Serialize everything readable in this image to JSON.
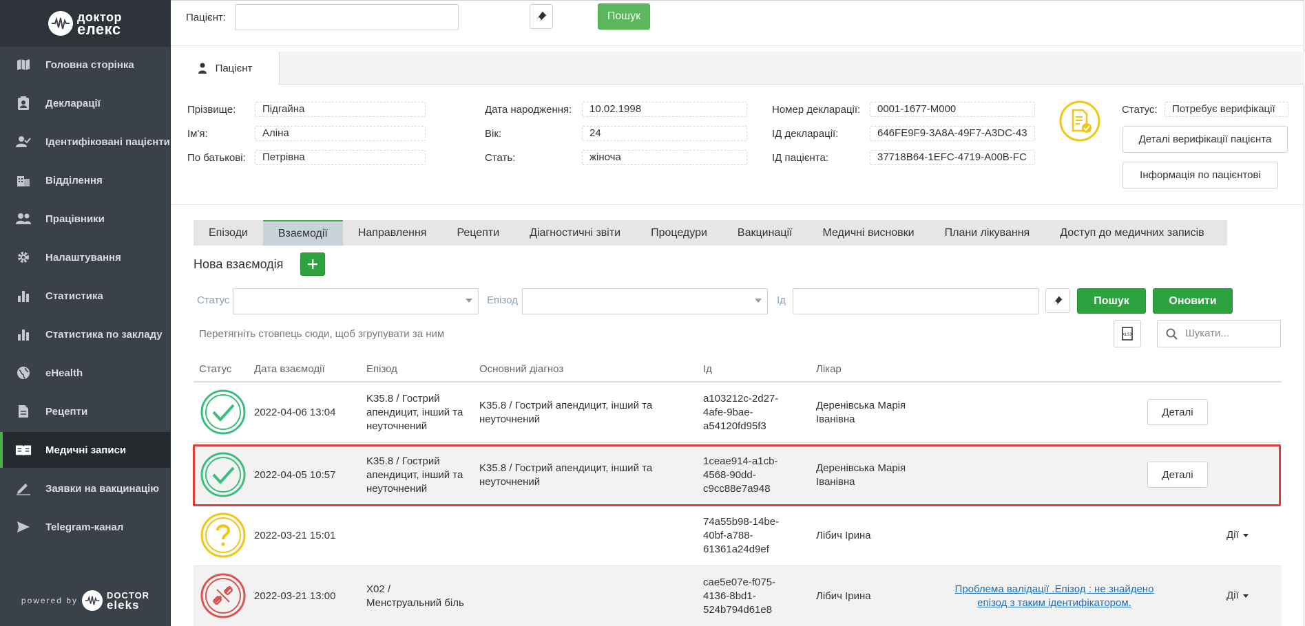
{
  "brand": {
    "logo_line1": "доктор",
    "logo_line2": "елекс",
    "powered_by": "powered by",
    "footer_line1": "DOCTOR",
    "footer_line2": "eleks"
  },
  "sidebar": {
    "items": [
      {
        "label": "Головна сторінка",
        "icon": "map-icon"
      },
      {
        "label": "Декларації",
        "icon": "clipboard-person-icon"
      },
      {
        "label": "Ідентифіковані пацієнти",
        "icon": "person-check-icon"
      },
      {
        "label": "Відділення",
        "icon": "building-icon"
      },
      {
        "label": "Працівники",
        "icon": "people-icon"
      },
      {
        "label": "Налаштування",
        "icon": "gear-icon"
      },
      {
        "label": "Статистика",
        "icon": "bar-chart-icon"
      },
      {
        "label": "Статистика по закладу",
        "icon": "bar-chart-icon"
      },
      {
        "label": "eHealth",
        "icon": "globe-icon"
      },
      {
        "label": "Рецепти",
        "icon": "document-icon"
      },
      {
        "label": "Медичні записи",
        "icon": "book-icon",
        "active": true
      },
      {
        "label": "Заявки на вакцинацію",
        "icon": "pencil-icon"
      },
      {
        "label": "Telegram-канал",
        "icon": "send-icon"
      }
    ]
  },
  "search": {
    "patient_label": "Пацієнт:",
    "patient_value": "",
    "search_button": "Пошук"
  },
  "patient_tab": {
    "label": "Пацієнт"
  },
  "patient": {
    "surname_label": "Прізвище:",
    "surname": "Підгайна",
    "name_label": "Ім'я:",
    "name": "Аліна",
    "patronymic_label": "По батькові:",
    "patronymic": "Петрівна",
    "dob_label": "Дата народження:",
    "dob": "10.02.1998",
    "age_label": "Вік:",
    "age": "24",
    "sex_label": "Стать:",
    "sex": "жіноча",
    "decl_num_label": "Номер декларації:",
    "decl_num": "0001-1677-M000",
    "decl_id_label": "ІД декларації:",
    "decl_id": "646FE9F9-3A8A-49F7-A3DC-43",
    "patient_id_label": "ІД пацієнта:",
    "patient_id": "37718B64-1EFC-4719-A00B-FC",
    "status_label": "Статус:",
    "status": "Потребує верифікації",
    "verify_details_button": "Деталі верифікації пацієнта",
    "patient_info_button": "Інформація по пацієнтові"
  },
  "record_tabs": [
    "Епізоди",
    "Взаємодії",
    "Направлення",
    "Рецепти",
    "Діагностичні звіти",
    "Процедури",
    "Вакцинації",
    "Медичні висновки",
    "Плани лікування",
    "Доступ до медичних записів"
  ],
  "active_record_tab": "Взаємодії",
  "interactions": {
    "new_label": "Нова взаємодія",
    "filter_status_label": "Статус",
    "filter_episode_label": "Епізод",
    "filter_id_label": "Ід",
    "search_button": "Пошук",
    "refresh_button": "Оновити",
    "group_hint": "Перетягніть стовпець сюди, щоб згрупувати за ним",
    "search_placeholder": "Шукати...",
    "columns": [
      "Статус",
      "Дата взаємодії",
      "Епізод",
      "Основний діагноз",
      "Ід",
      "Лікар"
    ],
    "rows": [
      {
        "status": "valid",
        "date": "2022-04-06 13:04",
        "episode": [
          "K35.8 / Гострий",
          "апендицит, інший та",
          "неуточнений"
        ],
        "diagnosis": [
          "K35.8 / Гострий апендицит, інший та",
          "неуточнений"
        ],
        "id": [
          "a103212c-2d27-",
          "4afe-9bae-",
          "a54120fd95f3"
        ],
        "doctor": [
          "Деренівська Марія",
          "Іванівна"
        ],
        "action": "Деталі"
      },
      {
        "status": "valid",
        "date": "2022-04-05 10:57",
        "episode": [
          "K35.8 / Гострий",
          "апендицит, інший та",
          "неуточнений"
        ],
        "diagnosis": [
          "K35.8 / Гострий апендицит, інший та",
          "неуточнений"
        ],
        "id": [
          "1ceae914-a1cb-",
          "4568-90dd-",
          "c9cc88e7a948"
        ],
        "doctor": [
          "Деренівська Марія",
          "Іванівна"
        ],
        "action": "Деталі"
      },
      {
        "status": "pending",
        "date": "2022-03-21 15:01",
        "episode": [],
        "diagnosis": [],
        "id": [
          "74a55b98-14be-",
          "40bf-a788-",
          "61361a24d9ef"
        ],
        "doctor": [
          "Лібич Ірина"
        ],
        "action": "Дії"
      },
      {
        "status": "error",
        "date": "2022-03-21 13:00",
        "episode": [
          "X02 /",
          "Менструальний біль"
        ],
        "diagnosis": [],
        "id": [
          "cae5e07e-f075-",
          "4136-8bd1-",
          "524b794d61e8"
        ],
        "doctor": [
          "Лібич Ірина"
        ],
        "validation": [
          "Проблема валідації .Епізод : не знайдено",
          "епізод з таким ідентифікатором."
        ],
        "action": "Дії"
      }
    ]
  },
  "colors": {
    "sidebar": "#3a4149",
    "accent_green": "#5cb85c",
    "valid": "#3dbd7d",
    "pending": "#f2c511",
    "error": "#d9534f",
    "highlight": "#e03c3c",
    "link": "#1f6fb5"
  }
}
